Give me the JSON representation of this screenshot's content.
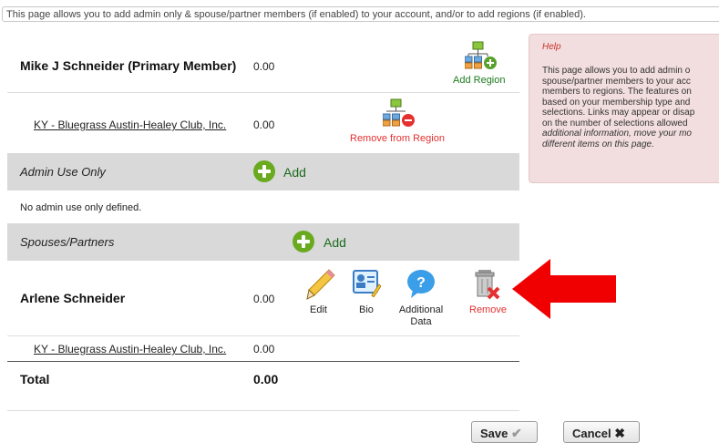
{
  "intro": "This page allows you to add admin only & spouse/partner members (if enabled) to your account, and/or to add regions (if enabled).",
  "primary": {
    "name": "Mike J Schneider (Primary Member)",
    "amount": "0.00",
    "add_region_label": "Add Region"
  },
  "region_row": {
    "name": "KY - Bluegrass Austin-Healey Club, Inc.",
    "amount": "0.00",
    "remove_label": "Remove from Region"
  },
  "admin_section": {
    "title": "Admin Use Only",
    "add_label": "Add",
    "empty_text": "No admin use only defined."
  },
  "spouse_section": {
    "title": "Spouses/Partners",
    "add_label": "Add"
  },
  "spouse": {
    "name": "Arlene Schneider",
    "amount": "0.00",
    "actions": {
      "edit": "Edit",
      "bio": "Bio",
      "additional": "Additional Data",
      "remove": "Remove"
    },
    "region": "KY - Bluegrass Austin-Healey Club, Inc.",
    "region_amount": "0.00"
  },
  "total": {
    "label": "Total",
    "amount": "0.00"
  },
  "help": {
    "title": "Help",
    "body_lines": [
      "This page allows you to add admin o",
      "spouse/partner members to your acc",
      "members to regions. The features on",
      "based on your membership type and",
      "selections. Links may appear or disap",
      "on the number of selections allowed"
    ],
    "body_italic_lines": [
      "additional information, move your mo",
      "different items on this page."
    ]
  },
  "buttons": {
    "save": "Save",
    "cancel": "Cancel"
  },
  "colors": {
    "section_bg": "#d9d9d9",
    "accent_green": "#6aaa1f",
    "remove_red": "#e53030",
    "help_bg": "#f2dede",
    "arrow_red": "#f00000"
  }
}
